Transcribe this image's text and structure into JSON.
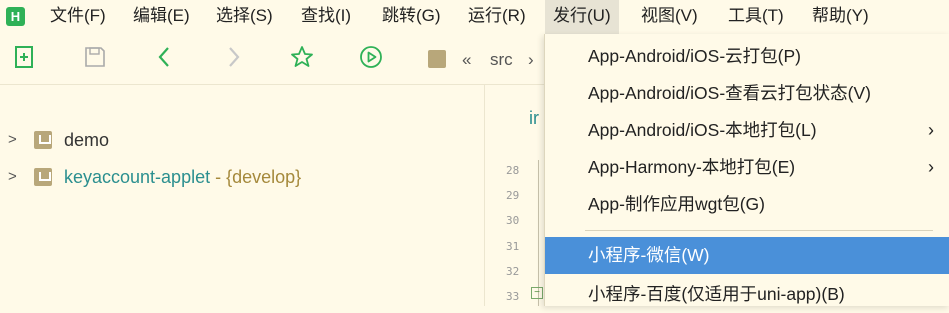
{
  "menubar": {
    "logo": "H",
    "items": [
      "文件(F)",
      "编辑(E)",
      "选择(S)",
      "查找(I)",
      "跳转(G)",
      "运行(R)",
      "发行(U)",
      "视图(V)",
      "工具(T)",
      "帮助(Y)"
    ]
  },
  "toolbar": {
    "crumb_chevrons": "«",
    "crumb_folder": "src",
    "crumb_next": "›"
  },
  "project_tree": {
    "items": [
      {
        "name": "demo",
        "branch": ""
      },
      {
        "name": "keyaccount-applet",
        "branch": " - {develop}"
      }
    ]
  },
  "editor": {
    "snippet": "ir",
    "line_numbers": [
      "28",
      "29",
      "30",
      "31",
      "32",
      "33"
    ]
  },
  "publish_menu": {
    "items": [
      {
        "label": "App-Android/iOS-云打包(P)",
        "submenu": false
      },
      {
        "label": "App-Android/iOS-查看云打包状态(V)",
        "submenu": false
      },
      {
        "label": "App-Android/iOS-本地打包(L)",
        "submenu": true
      },
      {
        "label": "App-Harmony-本地打包(E)",
        "submenu": true
      },
      {
        "label": "App-制作应用wgt包(G)",
        "submenu": false
      },
      {
        "label": "小程序-微信(W)",
        "submenu": false,
        "highlighted": true
      },
      {
        "label": "小程序-百度(仅适用于uni-app)(B)",
        "submenu": false
      }
    ],
    "submenu_arrow": "›"
  },
  "colors": {
    "background": "#fffae8",
    "highlight": "#4a90d9",
    "logo": "#2fb157",
    "project_icon": "#b8a77a",
    "link_text": "#2b8f8f"
  }
}
